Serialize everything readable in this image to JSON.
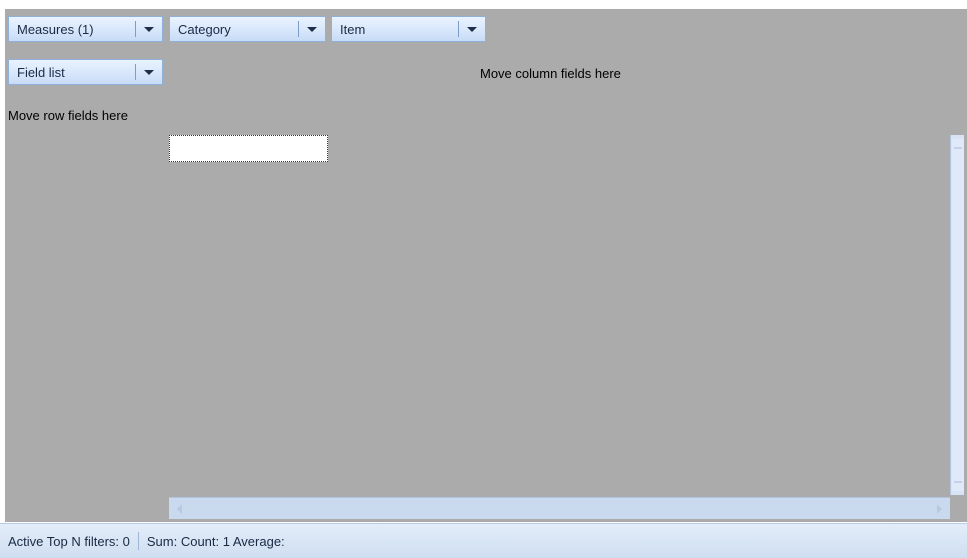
{
  "fields": {
    "measures": "Measures (1)",
    "category": "Category",
    "item": "Item",
    "field_list": "Field list"
  },
  "hints": {
    "column_fields": "Move column fields here",
    "row_fields": "Move row fields here"
  },
  "status": {
    "top_n": "Active Top N filters: 0",
    "stats": "Sum:  Count: 1 Average:"
  },
  "icons": {
    "dropdown": "chevron-down-icon"
  }
}
